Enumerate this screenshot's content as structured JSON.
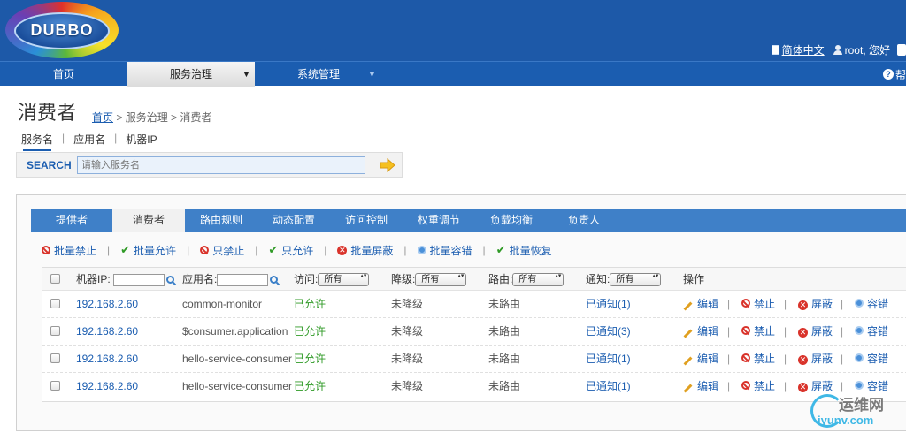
{
  "header": {
    "logo_text": "DUBBO",
    "language": "简体中文",
    "user": "root, 您好"
  },
  "nav": {
    "items": [
      {
        "label": "首页"
      },
      {
        "label": "服务治理"
      },
      {
        "label": "系统管理"
      }
    ],
    "help": "帮"
  },
  "page": {
    "title": "消费者",
    "breadcrumb": {
      "home": "首页",
      "rest": "> 服务治理 > 消费者"
    }
  },
  "search_tabs": [
    "服务名",
    "应用名",
    "机器IP"
  ],
  "search": {
    "label": "SEARCH",
    "placeholder": "请输入服务名"
  },
  "content_tabs": [
    "提供者",
    "消费者",
    "路由规则",
    "动态配置",
    "访问控制",
    "权重调节",
    "负载均衡",
    "负责人"
  ],
  "actions": {
    "batch_ban": "批量禁止",
    "batch_allow": "批量允许",
    "only_ban": "只禁止",
    "only_allow": "只允许",
    "batch_shield": "批量屏蔽",
    "batch_tolerate": "批量容错",
    "batch_recover": "批量恢复"
  },
  "table": {
    "headers": {
      "ip": "机器IP:",
      "app": "应用名:",
      "access": "访问:",
      "degrade": "降级:",
      "route": "路由:",
      "notify": "通知:",
      "ops": "操作"
    },
    "filter_all": "所有",
    "ops": {
      "edit": "编辑",
      "ban": "禁止",
      "shield": "屏蔽",
      "tolerate": "容错"
    },
    "rows": [
      {
        "ip": "192.168.2.60",
        "app": "common-monitor",
        "access": "已允许",
        "degrade": "未降级",
        "route": "未路由",
        "notify": "已通知(1)"
      },
      {
        "ip": "192.168.2.60",
        "app": "$consumer.application",
        "access": "已允许",
        "degrade": "未降级",
        "route": "未路由",
        "notify": "已通知(3)"
      },
      {
        "ip": "192.168.2.60",
        "app": "hello-service-consumer",
        "access": "已允许",
        "degrade": "未降级",
        "route": "未路由",
        "notify": "已通知(1)"
      },
      {
        "ip": "192.168.2.60",
        "app": "hello-service-consumer",
        "access": "已允许",
        "degrade": "未降级",
        "route": "未路由",
        "notify": "已通知(1)"
      }
    ]
  },
  "watermark": {
    "text": "运维网",
    "sub": "iyunv.com"
  },
  "colors": {
    "header_blue": "#1d59a8",
    "tab_blue": "#3f80c8",
    "link_blue": "#1b5db0",
    "status_green": "#2f9a26",
    "danger_red": "#d9332b"
  }
}
